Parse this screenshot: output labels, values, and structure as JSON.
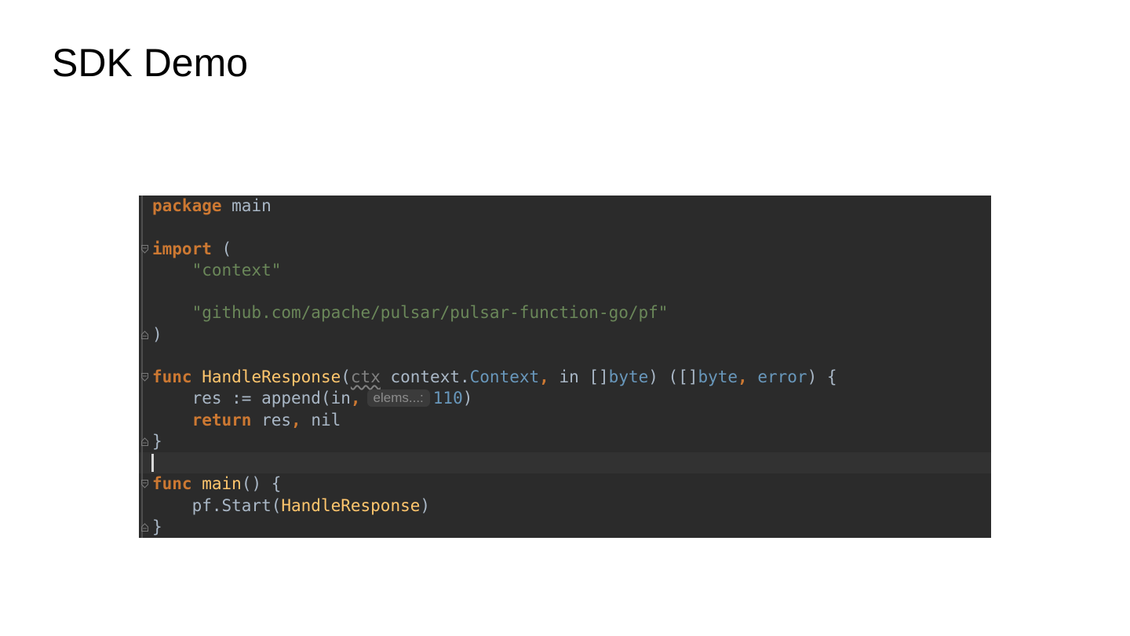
{
  "slide": {
    "title": "SDK Demo"
  },
  "editor": {
    "lines": {
      "l1": {
        "kw": "package",
        "rest": " main"
      },
      "l3": {
        "kw": "import",
        "rest": " ("
      },
      "l4": {
        "str": "\"context\""
      },
      "l6": {
        "str": "\"github.com/apache/pulsar/pulsar-function-go/pf\""
      },
      "l7": {
        "rest": ")"
      },
      "l9": {
        "kw": "func",
        "fn": "HandleResponse",
        "open": "(",
        "param": "ctx",
        "t1": " context.",
        "ty1": "Context",
        "c1": ",",
        "t2": " in []",
        "ty2": "byte",
        "t3": ") ([]",
        "ty3": "byte",
        "c2": ",",
        "ty4": "error",
        "t4": ") {"
      },
      "l10": {
        "t1": "res := append(in",
        "c1": ",",
        "hint": "elems...:",
        "num": "110",
        "t2": ")"
      },
      "l11": {
        "kw": "return",
        "t1": " res",
        "c1": ",",
        "t2": " nil"
      },
      "l12": {
        "rest": "}"
      },
      "l14": {
        "kw": "func",
        "fn": "main",
        "rest": "() {"
      },
      "l15": {
        "t1": "pf.Start(",
        "fn": "HandleResponse",
        "t2": ")"
      },
      "l16": {
        "rest": "}"
      }
    },
    "colors": {
      "background": "#2b2b2b",
      "keyword": "#cc7832",
      "string": "#6a8759",
      "function": "#ffc66d",
      "type": "#6897bb",
      "text": "#a9b7c6"
    }
  }
}
